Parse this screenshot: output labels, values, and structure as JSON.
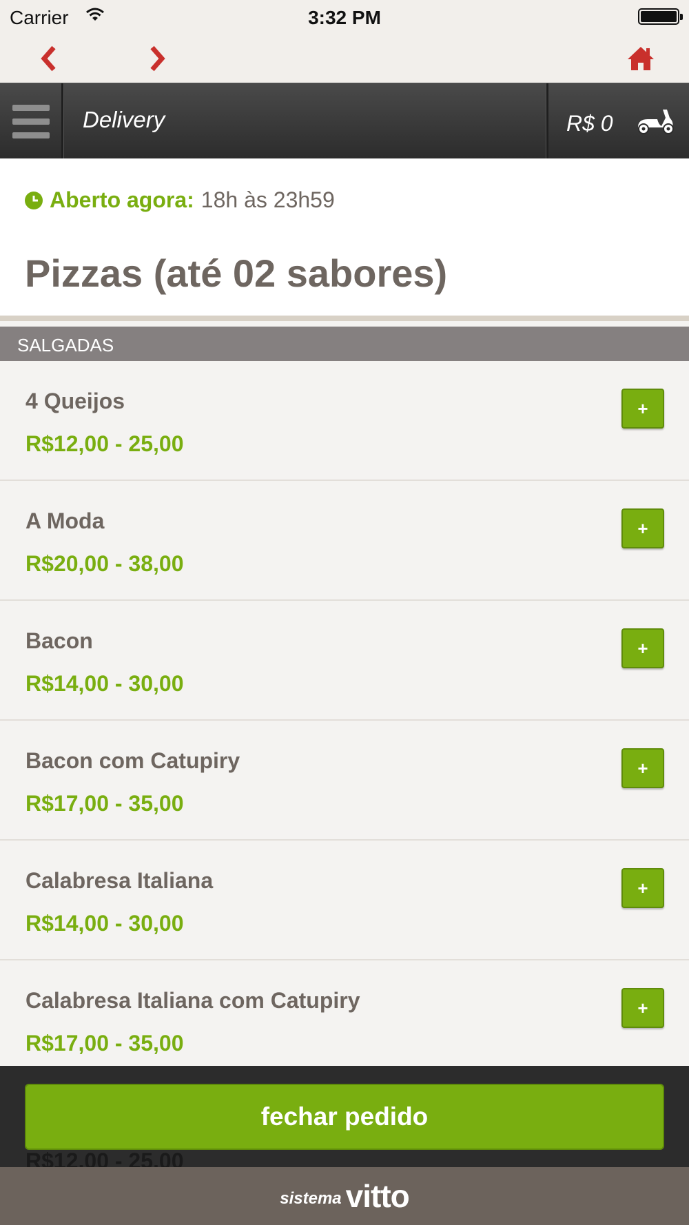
{
  "status_bar": {
    "carrier": "Carrier",
    "time": "3:32 PM"
  },
  "nav": {
    "back_icon": "chevron-left-icon",
    "forward_icon": "chevron-right-icon",
    "home_icon": "home-icon",
    "accent": "#c9302c"
  },
  "header": {
    "title": "Delivery",
    "cart_total": "R$ 0",
    "cart_icon": "scooter-icon"
  },
  "info": {
    "open_label": "Aberto agora:",
    "open_hours": "18h às 23h59",
    "title": "Pizzas (até 02 sabores)"
  },
  "section": {
    "label": "SALGADAS"
  },
  "items": [
    {
      "name": "4 Queijos",
      "price": "R$12,00 - 25,00",
      "add_label": "+"
    },
    {
      "name": "A Moda",
      "price": "R$20,00 - 38,00",
      "add_label": "+"
    },
    {
      "name": "Bacon",
      "price": "R$14,00 - 30,00",
      "add_label": "+"
    },
    {
      "name": "Bacon com Catupiry",
      "price": "R$17,00 - 35,00",
      "add_label": "+"
    },
    {
      "name": "Calabresa Italiana",
      "price": "R$14,00 - 30,00",
      "add_label": "+"
    },
    {
      "name": "Calabresa Italiana com Catupiry",
      "price": "R$17,00 - 35,00",
      "add_label": "+"
    }
  ],
  "ghost_price": "R$12,00 - 25,00",
  "checkout": {
    "label": "fechar pedido"
  },
  "footer": {
    "small": "sistema",
    "brand": "vitto"
  },
  "colors": {
    "green": "#79ae10",
    "text": "#6e6660",
    "red": "#c9302c"
  }
}
